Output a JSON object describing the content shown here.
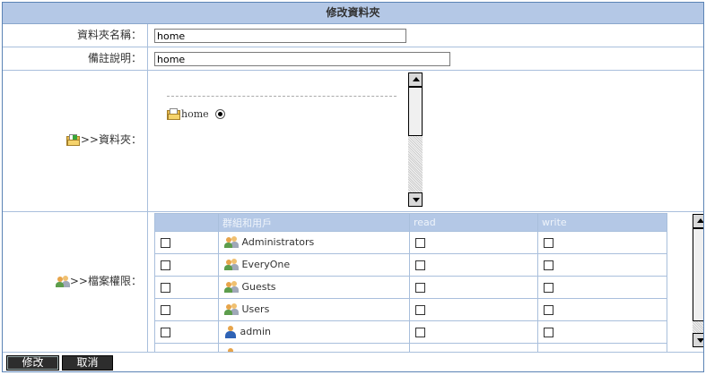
{
  "form": {
    "title": "修改資料夾",
    "folder_name_label": "資料夾名稱：",
    "folder_name_value": "home",
    "remark_label": "備註說明：",
    "remark_value": "home",
    "folder_label": ">>資料夾：",
    "folder_tree": {
      "item": "home",
      "selected": true
    },
    "permission_label": ">>檔案權限：",
    "permissions": {
      "headers": [
        "",
        "群組和用戶",
        "read",
        "write"
      ],
      "rows": [
        {
          "name": "Administrators",
          "icon": "group-icon"
        },
        {
          "name": "EveryOne",
          "icon": "group-icon"
        },
        {
          "name": "Guests",
          "icon": "group-icon"
        },
        {
          "name": "Users",
          "icon": "group-icon"
        },
        {
          "name": "admin",
          "icon": "user-icon"
        }
      ]
    },
    "buttons": {
      "edit": "修改",
      "cancel": "取消"
    }
  },
  "colors": {
    "header_bg": "#b4c8e6",
    "border": "#a9bfdc",
    "button_bg": "#2d2d2d"
  }
}
